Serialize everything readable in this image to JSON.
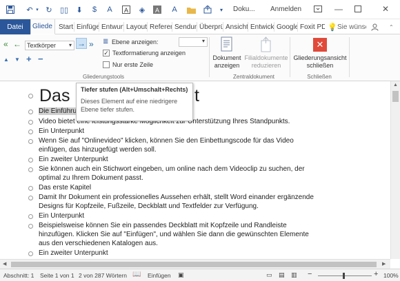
{
  "titlebar": {
    "document_title": "Doku...",
    "signin_label": "Anmelden"
  },
  "tabs": {
    "file": "Datei",
    "items": [
      "Gliede",
      "Start",
      "Einfüge",
      "Entwurf",
      "Layout",
      "Referen",
      "Sendun",
      "Überprü",
      "Ansicht",
      "Entwick",
      "Google",
      "Foxit PD"
    ],
    "active_index": 0,
    "search_label": "Sie wünsc"
  },
  "ribbon": {
    "style_select_value": "Textkörper",
    "show_level_label": "Ebene anzeigen:",
    "show_formatting_label": "Textformatierung anzeigen",
    "show_formatting_checked": true,
    "first_line_only_label": "Nur erste Zeile",
    "first_line_only_checked": false,
    "show_document_label": [
      "Dokument",
      "anzeigen"
    ],
    "collapse_subdocs_label": [
      "Filialdokumente",
      "reduzieren"
    ],
    "close_outline_label": [
      "Gliederungsansicht",
      "schließen"
    ],
    "group_outline_tools": "Gliederungstools",
    "group_master_document": "Zentraldokument",
    "group_close": "Schließen"
  },
  "tooltip": {
    "title": "Tiefer stufen (Alt+Umschalt+Rechts)",
    "body": "Dieses Element auf eine niedrigere Ebene tiefer stufen."
  },
  "document": {
    "heading_visible_start": "Das i",
    "heading_visible_end": "t",
    "lines": [
      "Die Einführu",
      "Video bietet eine leistungsstarke Möglichkeit zur Unterstützung Ihres Standpunkts.",
      "Ein Unterpunkt",
      "Wenn Sie auf \"Onlinevideo\" klicken, können Sie den Einbettungscode für das Video",
      "einfügen, das hinzugefügt werden soll.",
      "Ein zweiter Unterpunkt",
      "Sie können auch ein Stichwort eingeben, um online nach dem Videoclip zu suchen, der",
      "optimal zu Ihrem Dokument passt.",
      "Das erste Kapitel",
      "Damit Ihr Dokument ein professionelles Aussehen erhält, stellt Word einander ergänzende",
      "Designs für Kopfzeile, Fußzeile, Deckblatt und Textfelder zur Verfügung.",
      "Ein Unterpunkt",
      "Beispielsweise können Sie ein passendes Deckblatt mit Kopfzeile und Randleiste",
      "hinzufügen. Klicken Sie auf \"Einfügen\", und wählen Sie dann die gewünschten Elemente",
      "aus den verschiedenen Katalogen aus.",
      "Ein zweiter Unterpunkt"
    ]
  },
  "statusbar": {
    "section": "Abschnitt: 1",
    "page": "Seite 1 von 1",
    "words": "2 von 287 Wörtern",
    "mode": "Einfügen",
    "zoom": "100%"
  },
  "colors": {
    "accent": "#2b579a",
    "close_icon": "#e04a3a"
  }
}
